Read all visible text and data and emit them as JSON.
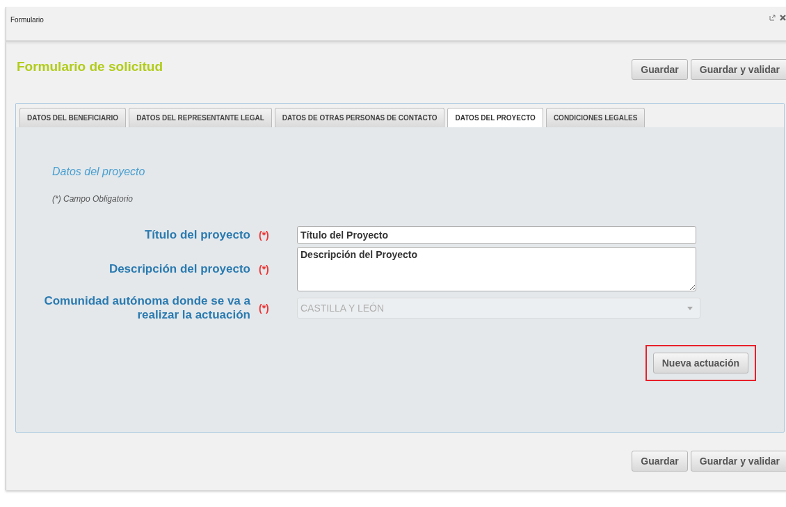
{
  "window": {
    "title": "Formulario"
  },
  "header": {
    "title": "Formulario de solicitud",
    "buttons": [
      "Guardar",
      "Guardar y validar"
    ]
  },
  "tabs": [
    {
      "label": "DATOS DEL BENEFICIARIO",
      "selected": false
    },
    {
      "label": "DATOS DEL REPRESENTANTE LEGAL",
      "selected": false
    },
    {
      "label": "DATOS DE OTRAS PERSONAS DE CONTACTO",
      "selected": false
    },
    {
      "label": "DATOS DEL PROYECTO",
      "selected": true
    },
    {
      "label": "CONDICIONES LEGALES",
      "selected": false
    }
  ],
  "section": {
    "title": "Datos del proyecto",
    "note": "(*) Campo Obligatorio"
  },
  "fields": [
    {
      "kind": "text",
      "label": "Título del proyecto",
      "required": "(*)",
      "value": "Título del Proyecto",
      "disabled": false
    },
    {
      "kind": "textarea",
      "label": "Descripción del proyecto",
      "required": "(*)",
      "value": "Descripción del Proyecto",
      "disabled": false
    },
    {
      "kind": "select",
      "label": "Comunidad autónoma donde se va a realizar la actuación",
      "required": "(*)",
      "value": "CASTILLA Y LEÓN",
      "disabled": true
    }
  ],
  "action_button": {
    "label": "Nueva actuación",
    "highlighted": true
  },
  "footer": {
    "buttons": [
      "Guardar",
      "Guardar y validar"
    ]
  }
}
